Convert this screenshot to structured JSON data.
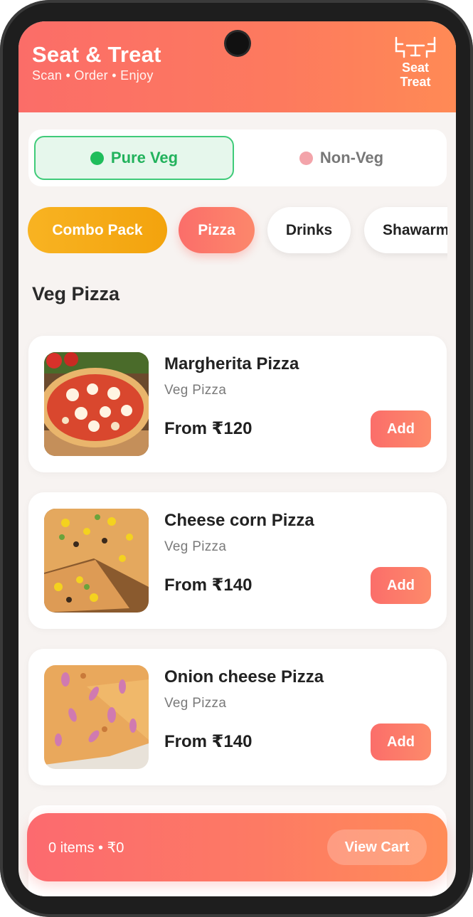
{
  "header": {
    "title": "Seat & Treat",
    "tagline": "Scan • Order • Enjoy",
    "logo_line1": "Seat",
    "logo_line2": "Treat"
  },
  "diet_filter": {
    "options": [
      {
        "label": "Pure Veg",
        "selected": true,
        "color": "#1fbd5b"
      },
      {
        "label": "Non-Veg",
        "selected": false,
        "color": "#f3a4aa"
      }
    ]
  },
  "categories": [
    {
      "label": "Combo Pack",
      "color": "#f5ab18"
    },
    {
      "label": "Pizza",
      "selected": true,
      "color": "#fb6e6a"
    },
    {
      "label": "Drinks"
    },
    {
      "label": "Shawarma"
    }
  ],
  "section_title": "Veg Pizza",
  "products": [
    {
      "name": "Margherita Pizza",
      "category": "Veg Pizza",
      "price": "From ₹120",
      "add_label": "Add"
    },
    {
      "name": "Cheese corn Pizza",
      "category": "Veg Pizza",
      "price": "From ₹140",
      "add_label": "Add"
    },
    {
      "name": "Onion cheese Pizza",
      "category": "Veg Pizza",
      "price": "From ₹140",
      "add_label": "Add"
    }
  ],
  "cart": {
    "summary": "0 items • ₹0",
    "button_label": "View Cart"
  },
  "colors": {
    "accent": "#fb6e6a",
    "accent_end": "#ff8a55",
    "veg_green": "#22b25c"
  }
}
